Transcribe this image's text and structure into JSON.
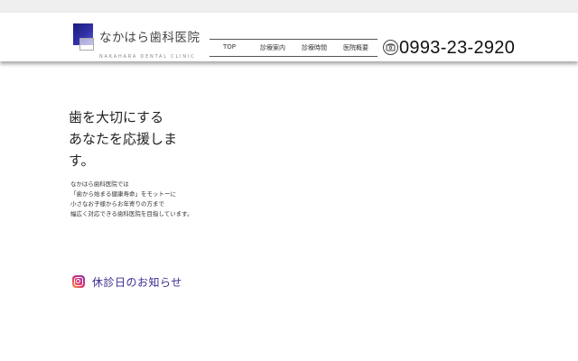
{
  "header": {
    "logo_name": "なかはら歯科医院",
    "logo_sub": "NAKAHARA DENTAL CLINIC",
    "nav": [
      {
        "label": "TOP"
      },
      {
        "label": "診療案内"
      },
      {
        "label": "診療時間"
      },
      {
        "label": "医院概要"
      }
    ],
    "phone_number": "0993-23-2920"
  },
  "hero": {
    "lines": [
      "歯を大切にする",
      "あなたを応援しま",
      "す。"
    ]
  },
  "description": {
    "lines": [
      "なかはら歯科医院では",
      "「歯から始まる健康寿命」をモットーに",
      "小さなお子様からお年寄りの方まで",
      "幅広く対応できる歯科医院を目指しています。"
    ]
  },
  "news": {
    "label": "休診日のお知らせ",
    "icon": "instagram-icon"
  },
  "colors": {
    "accent": "#3a2d8f",
    "logo_dark": "#1a1a7a"
  }
}
